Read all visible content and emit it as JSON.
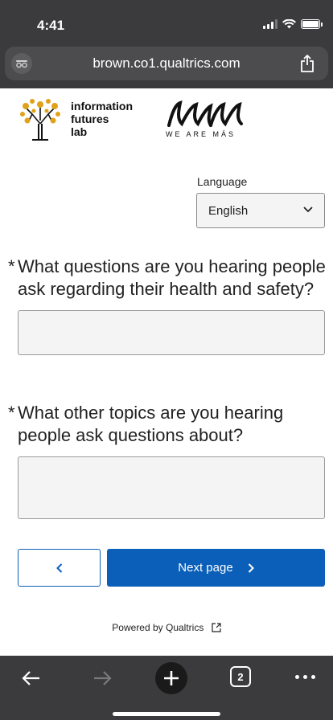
{
  "status_bar": {
    "time": "4:41"
  },
  "browser": {
    "url": "brown.co1.qualtrics.com",
    "icons": {
      "left": "privacy-icon",
      "share": "share-icon"
    }
  },
  "logos": {
    "ifl_line1": "information",
    "ifl_line2": "futures",
    "ifl_line3": "lab",
    "wam_tagline": "WE ARE MÁS"
  },
  "language": {
    "label": "Language",
    "selected": "English"
  },
  "questions": [
    {
      "asterisk": "*",
      "text": "What questions are you hearing people ask regarding their health and safety?",
      "answer": ""
    },
    {
      "asterisk": "*",
      "text": "What other topics are you hearing people ask questions about?",
      "answer": ""
    }
  ],
  "navigation": {
    "prev_label": "<",
    "next_label": "Next page",
    "next_arrow": ">"
  },
  "footer": {
    "powered_by": "Powered by Qualtrics"
  },
  "toolbar": {
    "tab_count": "2"
  },
  "colors": {
    "accent": "#0b5fb9",
    "chrome": "#3b3b3d"
  }
}
